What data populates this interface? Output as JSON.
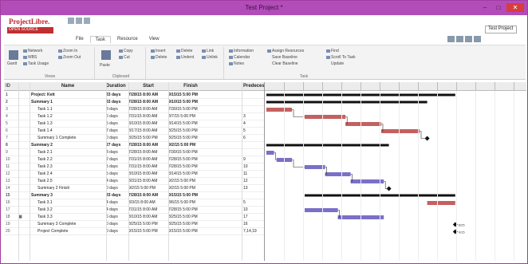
{
  "app": {
    "title": "Test Project *",
    "logo_brand": "ProjectLibre.",
    "logo_strip": "OPEN SOURCE",
    "search_box": "Test Project"
  },
  "window_buttons": [
    "–",
    "□",
    "✕"
  ],
  "tabs": [
    "File",
    "Task",
    "Resource",
    "View"
  ],
  "ribbon": {
    "views_group": {
      "label": "Views",
      "items": [
        "Network",
        "WBS",
        "Task Usage"
      ],
      "big": "Gantt",
      "col2": [
        "Zoom In",
        "Zoom Out"
      ]
    },
    "clipboard_group": {
      "label": "Clipboard",
      "big": "Paste",
      "items": [
        "Copy",
        "Cut"
      ]
    },
    "edit_group": {
      "items": [
        "Insert",
        "Delete",
        "Delete",
        "Undent",
        "Link",
        "Unlink"
      ]
    },
    "task_group": {
      "label": "Task",
      "items": [
        "Information",
        "Calendar",
        "Notes",
        "Assign Resources",
        "Save Baseline",
        "Clear Baseline",
        "Find",
        "Scroll To Task",
        "Update"
      ]
    }
  },
  "columns": [
    "ID",
    "",
    "Name",
    "Duration",
    "Start",
    "Finish",
    "Predecessors"
  ],
  "rows": [
    {
      "id": "1",
      "ind": "",
      "name": "Project: Kett",
      "dur": "33 days",
      "start": "7/28/15 8:00 AM",
      "finish": "9/15/15 5:00 PM",
      "pred": "",
      "sum": true
    },
    {
      "id": "2",
      "ind": "",
      "name": "Summary 1",
      "dur": "33 days",
      "start": "7/28/15 8:00 AM",
      "finish": "9/10/15 5:00 PM",
      "pred": "",
      "sum": true
    },
    {
      "id": "3",
      "ind": "",
      "name": "Task 1.1",
      "dur": "3 days",
      "start": "7/28/15 8:00 AM",
      "finish": "7/30/15 5:00 PM",
      "pred": "",
      "sum": false
    },
    {
      "id": "4",
      "ind": "",
      "name": "Task 1.2",
      "dur": "6 days",
      "start": "7/31/15 8:00 AM",
      "finish": "8/7/15 5:00 PM",
      "pred": "3",
      "sum": false
    },
    {
      "id": "5",
      "ind": "",
      "name": "Task 1.3",
      "dur": "5 days",
      "start": "8/10/15 8:00 AM",
      "finish": "8/14/15 5:00 PM",
      "pred": "4",
      "sum": false
    },
    {
      "id": "6",
      "ind": "",
      "name": "Task 1.4",
      "dur": "7 days",
      "start": "8/17/15 8:00 AM",
      "finish": "8/25/15 5:00 PM",
      "pred": "5",
      "sum": false
    },
    {
      "id": "7",
      "ind": "",
      "name": "Summary 1 Complete",
      "dur": "0 days",
      "start": "8/25/15 5:00 PM",
      "finish": "8/25/15 5:00 PM",
      "pred": "6",
      "sum": false
    },
    {
      "id": "8",
      "ind": "",
      "name": "Summary 2",
      "dur": "27 days",
      "start": "7/28/15 8:00 AM",
      "finish": "9/2/15 5:00 PM",
      "pred": "",
      "sum": true
    },
    {
      "id": "9",
      "ind": "",
      "name": "Task 2.1",
      "dur": "3 days",
      "start": "7/28/15 8:00 AM",
      "finish": "7/30/15 5:00 PM",
      "pred": "",
      "sum": false
    },
    {
      "id": "10",
      "ind": "",
      "name": "Task 2.2",
      "dur": "2 days",
      "start": "7/31/15 8:00 AM",
      "finish": "7/28/15 5:00 PM",
      "pred": "9",
      "sum": false
    },
    {
      "id": "11",
      "ind": "",
      "name": "Task 2.3",
      "dur": "5 days",
      "start": "7/31/15 8:00 AM",
      "finish": "7/28/15 5:00 PM",
      "pred": "10",
      "sum": false
    },
    {
      "id": "12",
      "ind": "",
      "name": "Task 2.4",
      "dur": "5 days",
      "start": "8/10/15 8:00 AM",
      "finish": "8/14/15 5:00 PM",
      "pred": "11",
      "sum": false
    },
    {
      "id": "13",
      "ind": "",
      "name": "Task 2.5",
      "dur": "4 days",
      "start": "8/31/15 8:00 AM",
      "finish": "9/2/15 5:00 PM",
      "pred": "12",
      "sum": false
    },
    {
      "id": "14",
      "ind": "",
      "name": "Summary 2 Finish",
      "dur": "0 days",
      "start": "9/2/15 5:00 PM",
      "finish": "9/2/15 5:00 PM",
      "pred": "13",
      "sum": false
    },
    {
      "id": "15",
      "ind": "",
      "name": "Summary 3",
      "dur": "33 days",
      "start": "7/28/15 8:00 AM",
      "finish": "9/15/15 5:00 PM",
      "pred": "",
      "sum": true
    },
    {
      "id": "16",
      "ind": "",
      "name": "Task 3.1",
      "dur": "4 days",
      "start": "8/3/15 8:00 AM",
      "finish": "8/6/15 5:00 PM",
      "pred": "5",
      "sum": false
    },
    {
      "id": "17",
      "ind": "",
      "name": "Task 3.2",
      "dur": "4 days",
      "start": "7/31/15 8:00 AM",
      "finish": "7/28/15 5:00 PM",
      "pred": "10",
      "sum": false
    },
    {
      "id": "18",
      "ind": "▦",
      "name": "Task 3.3",
      "dur": "6 days",
      "start": "8/10/15 8:00 AM",
      "finish": "8/25/15 5:00 PM",
      "pred": "17",
      "sum": false
    },
    {
      "id": "19",
      "ind": "",
      "name": "Summary 3 Complete",
      "dur": "0 days",
      "start": "8/25/15 5:00 PM",
      "finish": "8/25/15 5:00 PM",
      "pred": "16",
      "sum": false
    },
    {
      "id": "20",
      "ind": "",
      "name": "Project Complete",
      "dur": "0 days",
      "start": "9/15/15 5:00 PM",
      "finish": "9/15/15 5:00 PM",
      "pred": "7,14,19",
      "sum": false
    }
  ],
  "gantt": {
    "colors": {
      "summary": "#111111",
      "task_red": "#c46060",
      "task_blue": "#7a70c8",
      "milestone": "#111111"
    },
    "bars": [
      {
        "row": 0,
        "kind": "summary",
        "start": 0,
        "end": 0.74
      },
      {
        "row": 1,
        "kind": "summary",
        "start": 0,
        "end": 0.63
      },
      {
        "row": 2,
        "kind": "task_red",
        "start": 0,
        "end": 0.1
      },
      {
        "row": 3,
        "kind": "task_red",
        "start": 0.15,
        "end": 0.31
      },
      {
        "row": 4,
        "kind": "task_red",
        "start": 0.31,
        "end": 0.45
      },
      {
        "row": 5,
        "kind": "task_red",
        "start": 0.45,
        "end": 0.6
      },
      {
        "row": 6,
        "kind": "milestone",
        "start": 0.63,
        "end": 0.63
      },
      {
        "row": 7,
        "kind": "summary",
        "start": 0,
        "end": 0.48
      },
      {
        "row": 8,
        "kind": "task_blue",
        "start": 0,
        "end": 0.03
      },
      {
        "row": 9,
        "kind": "task_blue",
        "start": 0.04,
        "end": 0.1
      },
      {
        "row": 10,
        "kind": "task_blue",
        "start": 0.15,
        "end": 0.23
      },
      {
        "row": 11,
        "kind": "task_blue",
        "start": 0.23,
        "end": 0.33
      },
      {
        "row": 12,
        "kind": "task_blue",
        "start": 0.33,
        "end": 0.46
      },
      {
        "row": 13,
        "kind": "milestone",
        "start": 0.48,
        "end": 0.48
      },
      {
        "row": 14,
        "kind": "summary",
        "start": 0.15,
        "end": 0.74
      },
      {
        "row": 15,
        "kind": "task_red",
        "start": 0.63,
        "end": 0.74
      },
      {
        "row": 16,
        "kind": "task_blue",
        "start": 0.15,
        "end": 0.28
      },
      {
        "row": 17,
        "kind": "task_blue",
        "start": 0.28,
        "end": 0.46
      },
      {
        "row": 18,
        "kind": "milestone",
        "start": 0.74,
        "end": 0.74
      },
      {
        "row": 19,
        "kind": "milestone",
        "start": 0.74,
        "end": 0.74
      }
    ],
    "milestone_labels": {
      "6": "",
      "13": "",
      "18": "8/25",
      "19": "9/15"
    }
  }
}
